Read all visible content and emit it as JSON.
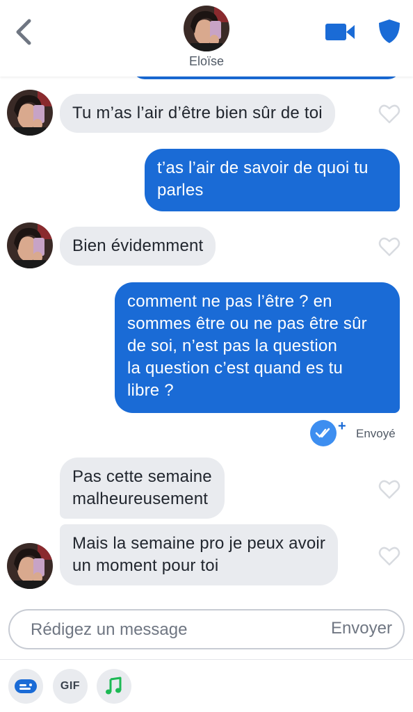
{
  "header": {
    "contact_name": "Eloïse"
  },
  "messages": [
    {
      "direction": "in",
      "text": "Tu m’as l’air d’être bien sûr de toi"
    },
    {
      "direction": "out",
      "text": "t’as l’air de savoir de quoi tu\nparles"
    },
    {
      "direction": "in",
      "text": "Bien évidemment"
    },
    {
      "direction": "out",
      "text": "comment ne pas l’être ? en\nsommes être ou ne pas être sûr\nde soi, n’est pas la question\nla question c’est quand es tu\nlibre ?"
    },
    {
      "direction": "in",
      "text": "Pas cette semaine\nmalheureusement"
    },
    {
      "direction": "in",
      "text": "Mais la semaine pro je peux avoir\nun moment pour toi"
    }
  ],
  "status": {
    "sent_label": "Envoyé",
    "plus": "+"
  },
  "composer": {
    "placeholder": "Rédigez un message",
    "send_label": "Envoyer"
  },
  "toolbar": {
    "gif_label": "GIF"
  },
  "icons": {
    "back": "chevron-left-icon",
    "video": "video-camera-icon",
    "safety": "shield-icon",
    "heart": "heart-outline-icon",
    "sticker": "sticker-icon",
    "music": "music-note-icon",
    "read": "double-check-icon"
  },
  "colors": {
    "accent": "#1a6bd6",
    "incoming_bubble": "#e9ebef",
    "music_green": "#1db954"
  }
}
